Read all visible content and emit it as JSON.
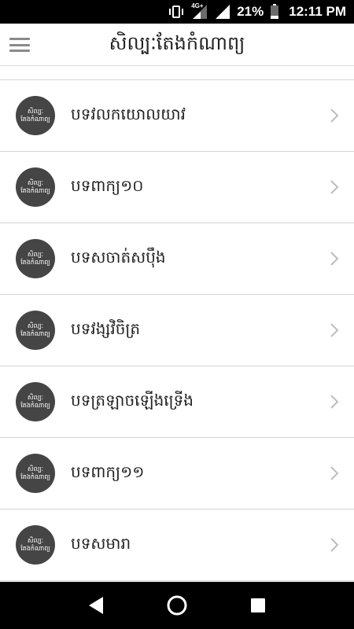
{
  "status_bar": {
    "network_type": "4G+",
    "battery_percent": "21%",
    "time": "12:11 PM"
  },
  "app_bar": {
    "title": "សិល្បៈតែងកំណាព្យ",
    "menu_icon": "hamburger-icon"
  },
  "avatar": {
    "line1": "សិល្បៈ",
    "line2": "តែងកំណាព្យ"
  },
  "items": [
    {
      "label": "បទវលកយោលយាវ"
    },
    {
      "label": "បទពាក្យ១០"
    },
    {
      "label": "បទសចាត់សប៉ឹង"
    },
    {
      "label": "បទវង្សវិចិត្រ"
    },
    {
      "label": "បទត្រឡាចឡើងទ្រើង"
    },
    {
      "label": "បទពាក្យ១១"
    },
    {
      "label": "បទសមារា"
    }
  ],
  "colors": {
    "avatar_bg": "#454545",
    "divider": "#d4d4d4",
    "chevron": "#bdbdbd",
    "system_bars": "#000000"
  },
  "nav_bar": {
    "back_icon": "back-triangle-icon",
    "home_icon": "home-circle-icon",
    "recents_icon": "recents-square-icon"
  }
}
